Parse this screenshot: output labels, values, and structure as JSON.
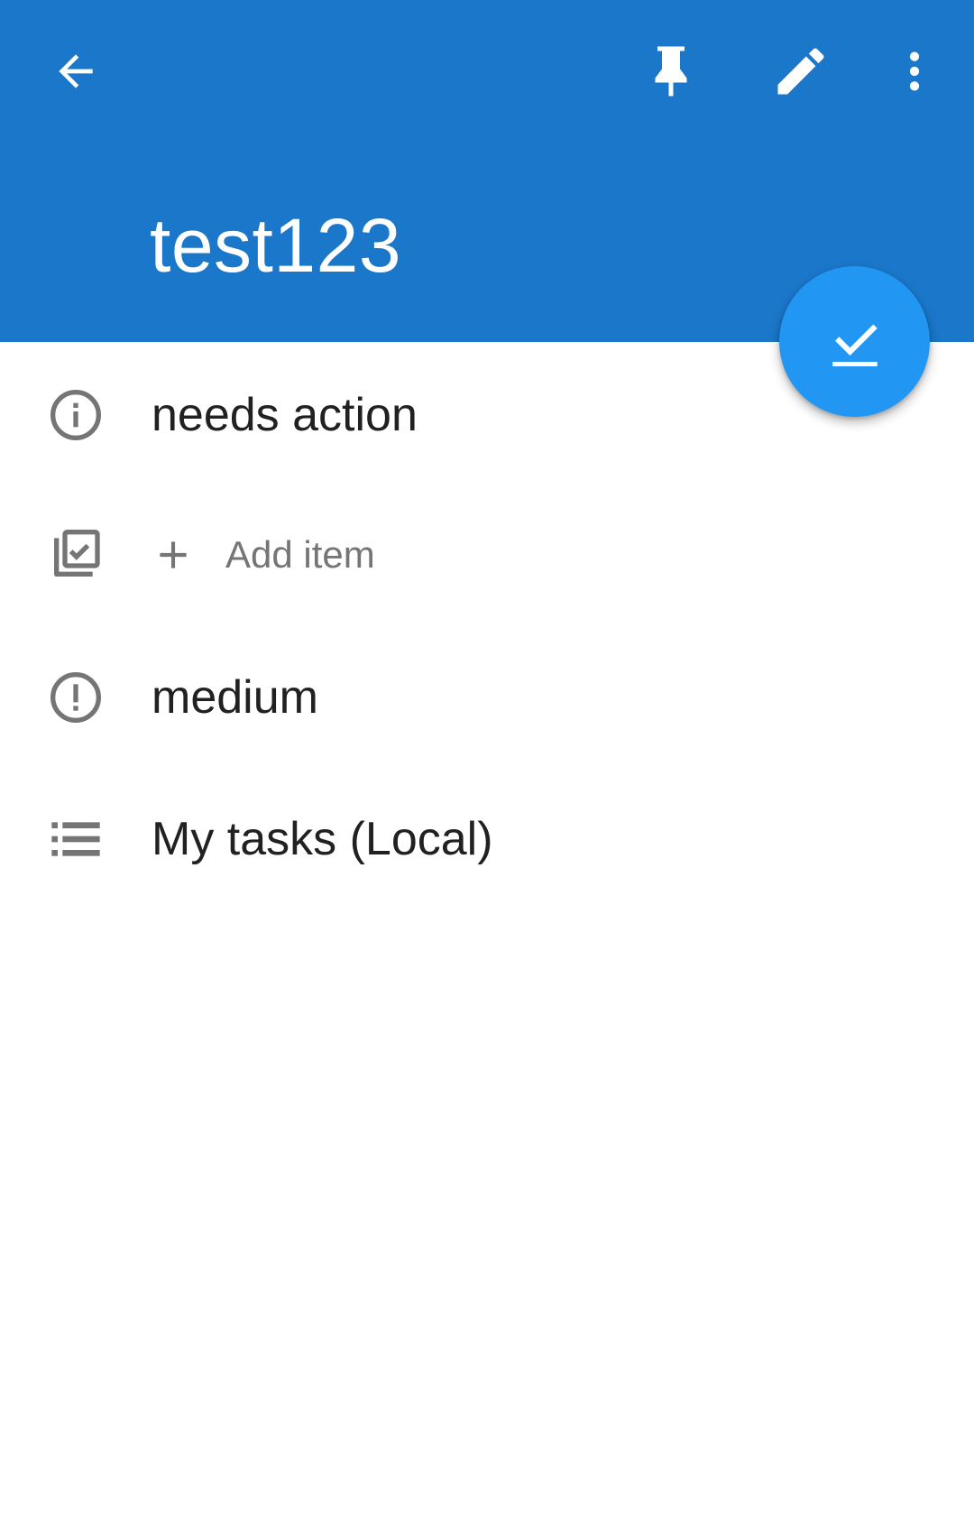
{
  "toolbar": {
    "back_icon": "arrow-back-icon",
    "pin_icon": "pin-icon",
    "edit_icon": "edit-pencil-icon",
    "more_icon": "more-vert-icon",
    "background_color": "#1b77c9"
  },
  "task": {
    "title": "test123"
  },
  "fab": {
    "icon": "check-done-icon",
    "color": "#2196f3"
  },
  "details": {
    "status": {
      "icon": "info-icon",
      "label": "needs action"
    },
    "subtasks": {
      "icon": "checklist-icon",
      "add_icon": "plus-icon",
      "add_label": "Add item"
    },
    "priority": {
      "icon": "priority-alert-icon",
      "label": "medium"
    },
    "list": {
      "icon": "list-icon",
      "label": "My tasks (Local)"
    }
  }
}
